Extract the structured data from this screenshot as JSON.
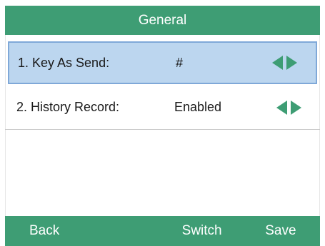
{
  "header": {
    "title": "General"
  },
  "settings": [
    {
      "label": "1. Key As Send:",
      "value": "#"
    },
    {
      "label": "2. History Record:",
      "value": "Enabled"
    }
  ],
  "softkeys": [
    "Back",
    "",
    "Switch",
    "Save"
  ],
  "colors": {
    "accent": "#3e9d74",
    "selection": "#bcd6ef",
    "selection_border": "#7fa8d8"
  },
  "icons": {
    "prev": "triangle-left-icon",
    "next": "triangle-right-icon"
  }
}
